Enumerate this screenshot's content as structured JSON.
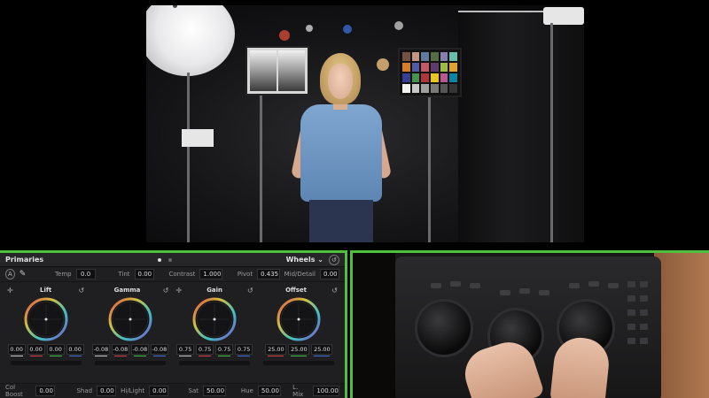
{
  "panel": {
    "title": "Primaries",
    "mode": "Wheels"
  },
  "adjust": {
    "temp": {
      "label": "Temp",
      "value": "0.0"
    },
    "tint": {
      "label": "Tint",
      "value": "0.00"
    },
    "contrast": {
      "label": "Contrast",
      "value": "1.000"
    },
    "pivot": {
      "label": "Pivot",
      "value": "0.435"
    },
    "mid_detail": {
      "label": "Mid/Detail",
      "value": "0.00"
    }
  },
  "wheels": [
    {
      "name": "Lift",
      "values": [
        "0.00",
        "0.00",
        "0.00",
        "0.00"
      ],
      "ring_color": "#c04a8a"
    },
    {
      "name": "Gamma",
      "values": [
        "-0.08",
        "-0.08",
        "-0.08",
        "-0.08"
      ],
      "ring_color": "#c04a8a"
    },
    {
      "name": "Gain",
      "values": [
        "0.75",
        "0.75",
        "0.75",
        "0.75"
      ],
      "ring_color": "#c04a8a"
    },
    {
      "name": "Offset",
      "values": [
        "25.00",
        "25.00",
        "25.00"
      ],
      "ring_color": "#c04a8a"
    }
  ],
  "bottom": {
    "col_boost": {
      "label": "Col Boost",
      "value": "0.00"
    },
    "shad": {
      "label": "Shad",
      "value": "0.00"
    },
    "hilight": {
      "label": "Hi/Light",
      "value": "0.00"
    },
    "sat": {
      "label": "Sat",
      "value": "50.00"
    },
    "hue": {
      "label": "Hue",
      "value": "50.00"
    },
    "lmix": {
      "label": "L. Mix",
      "value": "100.00"
    }
  },
  "colors": {
    "highlight_border": "#4fbf3f",
    "panel_bg": "#1f1f21"
  },
  "icons": {
    "auto": "auto-balance-icon",
    "picker": "eyedropper-icon",
    "reset": "reset-icon",
    "crosshair": "crosshair-icon"
  }
}
